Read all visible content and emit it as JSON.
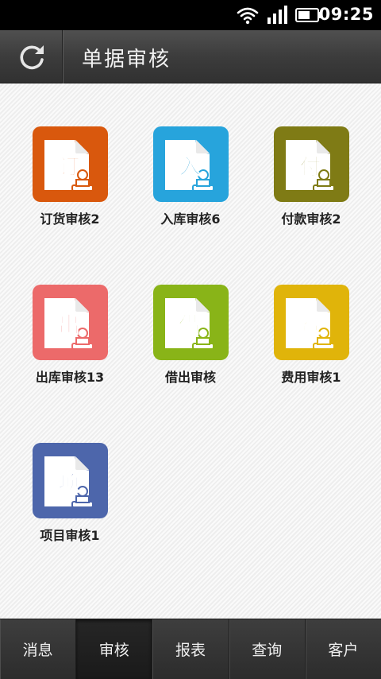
{
  "status_bar": {
    "time": "09:25",
    "icons": [
      "wifi-icon",
      "signal-icon",
      "battery-icon"
    ]
  },
  "header": {
    "title": "单据审核",
    "refresh_icon": "refresh-icon"
  },
  "tiles": [
    {
      "char": "订",
      "label": "订货审核2",
      "color": "#d9580d",
      "char_color": "#e8692a"
    },
    {
      "char": "入",
      "label": "入库审核6",
      "color": "#27a4dc",
      "char_color": "#2aa3d9"
    },
    {
      "char": "付",
      "label": "付款审核2",
      "color": "#7f7b15",
      "char_color": "#8a8520"
    },
    {
      "char": "出",
      "label": "出库审核13",
      "color": "#ec6a6a",
      "char_color": "#ef7a7a"
    },
    {
      "char": "借",
      "label": "借出审核",
      "color": "#89b418",
      "char_color": "#8fb81c"
    },
    {
      "char": "费",
      "label": "费用审核1",
      "color": "#e0b40a",
      "char_color": "#d9b10d"
    },
    {
      "char": "项",
      "label": "项目审核1",
      "color": "#4d66ab",
      "char_color": "#5570b6"
    }
  ],
  "nav": {
    "tabs": [
      "消息",
      "审核",
      "报表",
      "查询",
      "客户"
    ],
    "active": "审核"
  }
}
